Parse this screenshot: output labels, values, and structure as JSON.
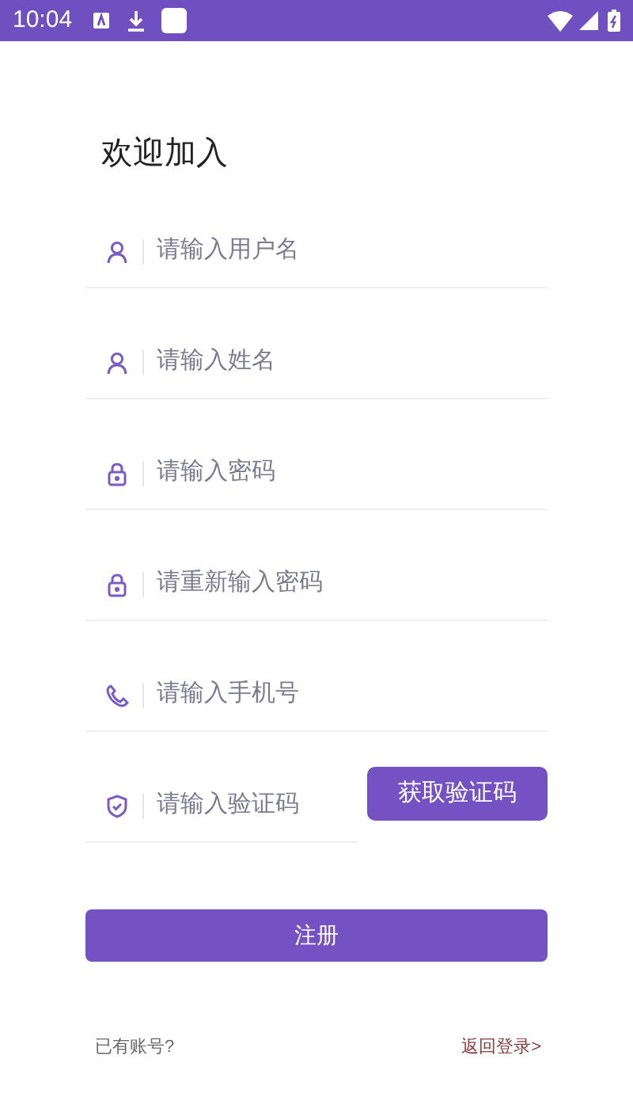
{
  "status_bar": {
    "time": "10:04"
  },
  "title": "欢迎加入",
  "fields": [
    {
      "kind": "user",
      "placeholder": "请输入用户名"
    },
    {
      "kind": "user",
      "placeholder": "请输入姓名"
    },
    {
      "kind": "lock",
      "placeholder": "请输入密码"
    },
    {
      "kind": "lock",
      "placeholder": "请重新输入密码"
    },
    {
      "kind": "phone",
      "placeholder": "请输入手机号"
    },
    {
      "kind": "shield",
      "placeholder": "请输入验证码",
      "button": "获取验证码"
    }
  ],
  "register_button": "注册",
  "footer": {
    "prompt": "已有账号?",
    "link": "返回登录>"
  }
}
